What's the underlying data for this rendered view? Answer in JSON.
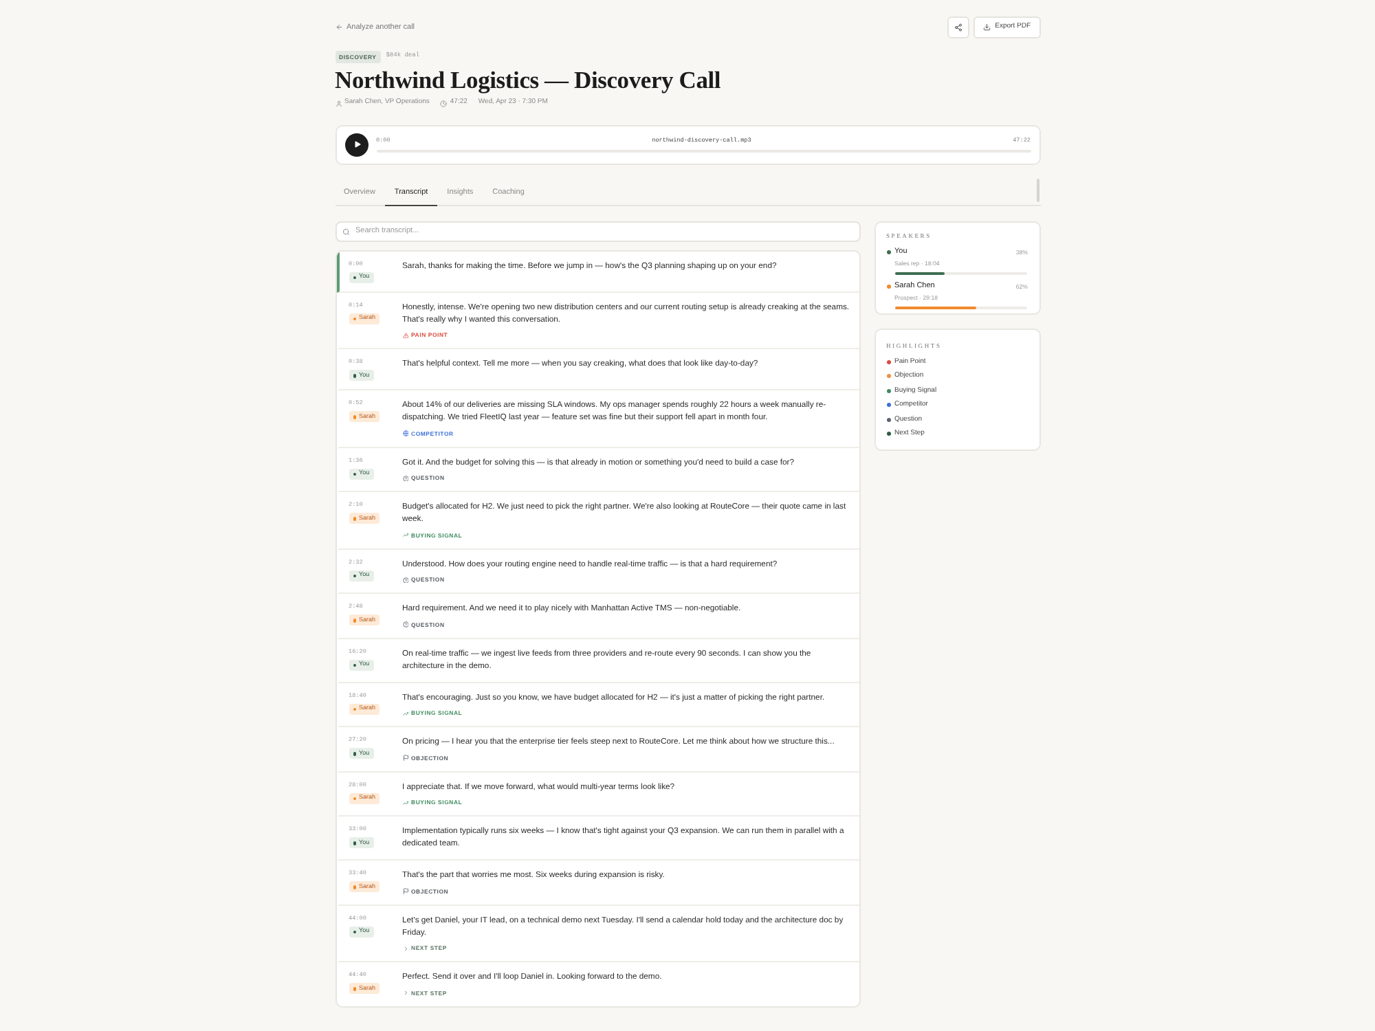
{
  "back_link": {
    "label": "Analyze another call"
  },
  "toolbar_buttons": [
    {
      "kind": "share"
    },
    {
      "kind": "export",
      "label": "Export PDF"
    }
  ],
  "call": {
    "stage_badge": "DISCOVERY",
    "deal_value": "$84k deal",
    "title": "Northwind Logistics — Discovery Call",
    "contact": "Sarah Chen, VP Operations",
    "duration": "47:22",
    "date": "Wed, Apr 23 · 7:30 PM"
  },
  "player": {
    "playing": false,
    "current_time": "0:00",
    "file_name": "northwind-discovery-call.mp3",
    "total_time": "47:22"
  },
  "tabs": [
    {
      "label": "Overview",
      "selected": false
    },
    {
      "label": "Transcript",
      "selected": true
    },
    {
      "label": "Insights",
      "selected": false
    },
    {
      "label": "Coaching",
      "selected": false
    }
  ],
  "search": {
    "placeholder": "Search transcript..."
  },
  "transcript": [
    {
      "time": "0:00",
      "kind": "rep",
      "speaker": "You",
      "text": "Sarah, thanks for making the time. Before we jump in — how's the Q3 planning shaping up on your end?",
      "selected": true
    },
    {
      "time": "0:14",
      "kind": "prospect",
      "speaker": "Sarah",
      "text": "Honestly, intense. We're opening two new distribution centers and our current routing setup is already creaking at the seams. That's really why I wanted this conversation.",
      "selected": false,
      "tag": {
        "kind": "pain_point",
        "label": "PAIN POINT"
      }
    },
    {
      "time": "0:38",
      "kind": "rep",
      "speaker": "You",
      "text": "That's helpful context. Tell me more — when you say creaking, what does that look like day-to-day?",
      "selected": false
    },
    {
      "time": "0:52",
      "kind": "prospect",
      "speaker": "Sarah",
      "text": "About 14% of our deliveries are missing SLA windows. My ops manager spends roughly 22 hours a week manually re-dispatching. We tried FleetIQ last year — feature set was fine but their support fell apart in month four.",
      "selected": false,
      "tag": {
        "kind": "competitor",
        "label": "COMPETITOR"
      }
    },
    {
      "time": "1:36",
      "kind": "rep",
      "speaker": "You",
      "text": "Got it. And the budget for solving this — is that already in motion or something you'd need to build a case for?",
      "selected": false,
      "tag": {
        "kind": "question",
        "label": "QUESTION"
      }
    },
    {
      "time": "2:10",
      "kind": "prospect",
      "speaker": "Sarah",
      "text": "Budget's allocated for H2. We just need to pick the right partner. We're also looking at RouteCore — their quote came in last week.",
      "selected": false,
      "tag": {
        "kind": "buying_signal",
        "label": "BUYING SIGNAL"
      }
    },
    {
      "time": "2:32",
      "kind": "rep",
      "speaker": "You",
      "text": "Understood. How does your routing engine need to handle real-time traffic — is that a hard requirement?",
      "selected": false,
      "tag": {
        "kind": "question",
        "label": "QUESTION"
      }
    },
    {
      "time": "2:48",
      "kind": "prospect",
      "speaker": "Sarah",
      "text": "Hard requirement. And we need it to play nicely with Manhattan Active TMS — non-negotiable.",
      "selected": false,
      "tag": {
        "kind": "question",
        "label": "QUESTION"
      }
    },
    {
      "time": "16:20",
      "kind": "rep",
      "speaker": "You",
      "text": "On real-time traffic — we ingest live feeds from three providers and re-route every 90 seconds. I can show you the architecture in the demo.",
      "selected": false
    },
    {
      "time": "18:40",
      "kind": "prospect",
      "speaker": "Sarah",
      "text": "That's encouraging. Just so you know, we have budget allocated for H2 — it's just a matter of picking the right partner.",
      "selected": false,
      "tag": {
        "kind": "buying_signal",
        "label": "BUYING SIGNAL"
      }
    },
    {
      "time": "27:20",
      "kind": "rep",
      "speaker": "You",
      "text": "On pricing — I hear you that the enterprise tier feels steep next to RouteCore. Let me think about how we structure this...",
      "selected": false,
      "tag": {
        "kind": "objection",
        "label": "OBJECTION"
      }
    },
    {
      "time": "28:00",
      "kind": "prospect",
      "speaker": "Sarah",
      "text": "I appreciate that. If we move forward, what would multi-year terms look like?",
      "selected": false,
      "tag": {
        "kind": "buying_signal",
        "label": "BUYING SIGNAL"
      }
    },
    {
      "time": "33:00",
      "kind": "rep",
      "speaker": "You",
      "text": "Implementation typically runs six weeks — I know that's tight against your Q3 expansion. We can run them in parallel with a dedicated team.",
      "selected": false
    },
    {
      "time": "33:40",
      "kind": "prospect",
      "speaker": "Sarah",
      "text": "That's the part that worries me most. Six weeks during expansion is risky.",
      "selected": false,
      "tag": {
        "kind": "objection",
        "label": "OBJECTION"
      }
    },
    {
      "time": "44:00",
      "kind": "rep",
      "speaker": "You",
      "text": "Let's get Daniel, your IT lead, on a technical demo next Tuesday. I'll send a calendar hold today and the architecture doc by Friday.",
      "selected": false,
      "tag": {
        "kind": "next_step",
        "label": "NEXT STEP"
      }
    },
    {
      "time": "44:40",
      "kind": "prospect",
      "speaker": "Sarah",
      "text": "Perfect. Send it over and I'll loop Daniel in. Looking forward to the demo.",
      "selected": false,
      "tag": {
        "kind": "next_step",
        "label": "NEXT STEP"
      }
    }
  ],
  "speakers": {
    "title": "SPEAKERS",
    "items": [
      {
        "name": "You",
        "share": "38%",
        "detail": "Sales rep · 18:04",
        "level": 0.38,
        "color": "#3f6e52"
      },
      {
        "name": "Sarah Chen",
        "share": "62%",
        "detail": "Prospect · 29:18",
        "level": 0.62,
        "color": "#f08a2c"
      }
    ]
  },
  "highlights": {
    "title": "HIGHLIGHTS",
    "items": [
      {
        "label": "Pain Point",
        "color": "#db4a3d"
      },
      {
        "label": "Objection",
        "color": "#f0923a"
      },
      {
        "label": "Buying Signal",
        "color": "#3e8b5e"
      },
      {
        "label": "Competitor",
        "color": "#3c6fd6"
      },
      {
        "label": "Question",
        "color": "#5d6470"
      },
      {
        "label": "Next Step",
        "color": "#2f5d45"
      }
    ]
  }
}
